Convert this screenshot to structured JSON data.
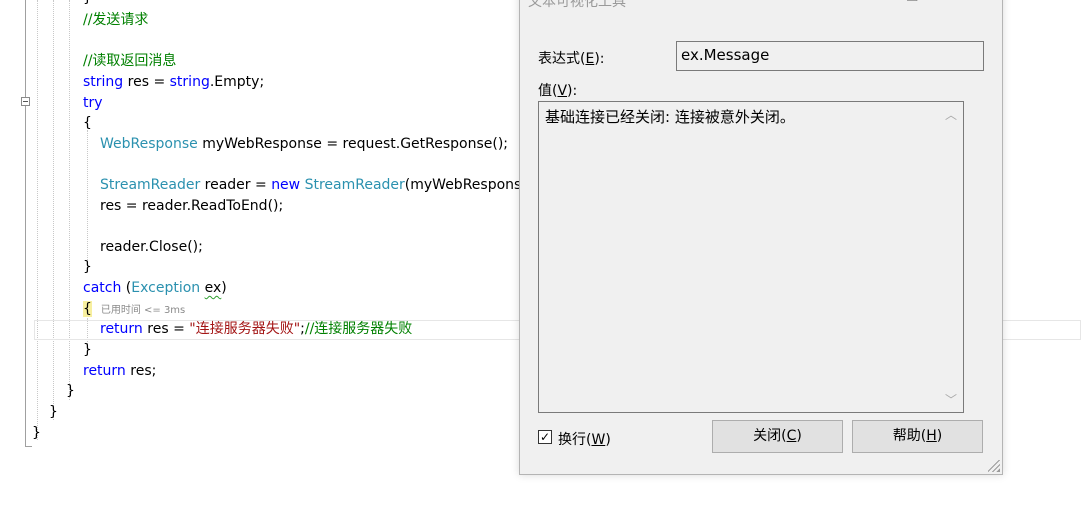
{
  "code": {
    "line_0": "}",
    "comment_send": "//发送请求",
    "comment_read": "//读取返回消息",
    "res_decl": {
      "kw1": "string",
      "mid": " res = ",
      "kw2": "string",
      "end": ".Empty;"
    },
    "try": "try",
    "open_brace": "{",
    "close_brace": "}",
    "web_response": {
      "type": "WebResponse",
      "rest": " myWebResponse = request.GetResponse();"
    },
    "stream_reader": {
      "type1": "StreamReader",
      "mid": " reader = ",
      "kw": "new",
      "sp": " ",
      "type2": "StreamReader",
      "rest": "(myWebResponse.G"
    },
    "read_to_end": "res = reader.ReadToEnd();",
    "reader_close": "reader.Close();",
    "catch_line": {
      "kw": "catch",
      "p1": " (",
      "type": "Exception",
      "sp": " ",
      "var": "ex",
      "p2": ")"
    },
    "elapsed_hint": "已用时间 <= 3ms",
    "return_line": {
      "kw": "return",
      "mid": " res = ",
      "str": "\"连接服务器失败\"",
      "semi": ";",
      "cm": "//连接服务器失败"
    },
    "return_res": {
      "kw": "return",
      "rest": " res;"
    }
  },
  "dialog": {
    "title": "文本可视化工具",
    "minimize": "—",
    "maximize": "☐",
    "close": "✕",
    "expression_label": "表达式(",
    "expression_key": "E",
    "expression_suffix": "):",
    "expression_value": "ex.Message",
    "value_label": "值(",
    "value_key": "V",
    "value_suffix": "):",
    "value_text": "基础连接已经关闭: 连接被意外关闭。",
    "wrap_checked": "✓",
    "wrap_label": "换行(",
    "wrap_key": "W",
    "wrap_suffix": ")",
    "close_button_label": "关闭(",
    "close_button_key": "C",
    "close_button_suffix": ")",
    "help_button_label": "帮助(",
    "help_button_key": "H",
    "help_button_suffix": ")"
  }
}
